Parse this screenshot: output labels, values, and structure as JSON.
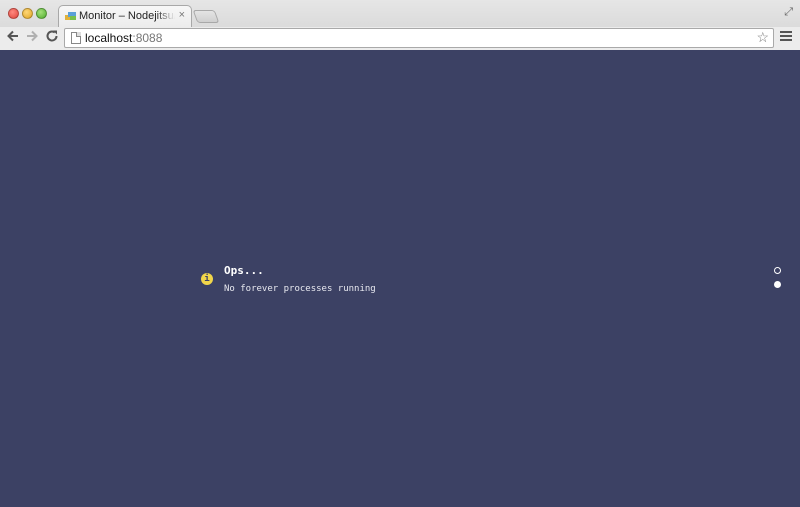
{
  "browser": {
    "tab_title": "Monitor – Nodejitsu/forever",
    "tab_close": "×",
    "url_host": "localhost",
    "url_port": ":8088",
    "icons": {
      "back": "arrow-left-icon",
      "forward": "arrow-right-icon",
      "reload": "reload-icon",
      "star": "star-icon",
      "menu": "hamburger-icon"
    }
  },
  "page": {
    "background": "#3c4164",
    "message": {
      "icon": "info-icon",
      "icon_glyph": "i",
      "icon_color": "#f1d54a",
      "title": "Ops...",
      "body": "No forever processes running"
    },
    "pagination": {
      "count": 2,
      "active_index": 1
    }
  }
}
